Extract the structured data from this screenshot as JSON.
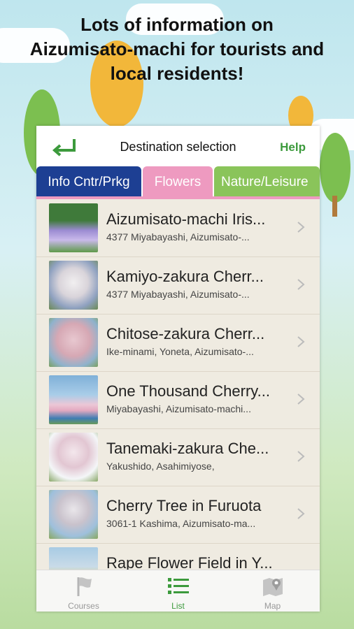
{
  "headline": {
    "line1": "Lots of information on",
    "line2": "Aizumisato-machi for tourists and",
    "line3": "local residents!"
  },
  "navbar": {
    "title": "Destination selection",
    "help": "Help"
  },
  "tabs": [
    {
      "label": "Info Cntr/Prkg"
    },
    {
      "label": "Flowers"
    },
    {
      "label": "Nature/Leisure"
    }
  ],
  "items": [
    {
      "title": "Aizumisato-machi Iris...",
      "address": "4377 Miyabayashi, Aizumisato-..."
    },
    {
      "title": "Kamiyo-zakura Cherr...",
      "address": "4377 Miyabayashi, Aizumisato-..."
    },
    {
      "title": "Chitose-zakura Cherr...",
      "address": "Ike-minami, Yoneta, Aizumisato-..."
    },
    {
      "title": "One Thousand Cherry...",
      "address": "Miyabayashi, Aizumisato-machi..."
    },
    {
      "title": "Tanemaki-zakura Che...",
      "address": "Yakushido, Asahimiyose,"
    },
    {
      "title": "Cherry Tree in Furuota",
      "address": "3061-1 Kashima, Aizumisato-ma..."
    },
    {
      "title": "Rape Flower Field in Y...",
      "address": ""
    }
  ],
  "tabbar": {
    "courses": "Courses",
    "list": "List",
    "map": "Map"
  },
  "colors": {
    "accent_green": "#3c9a3c",
    "tab_info": "#1d3f93",
    "tab_flowers": "#ee9ac0",
    "tab_nature": "#8ac45a"
  }
}
